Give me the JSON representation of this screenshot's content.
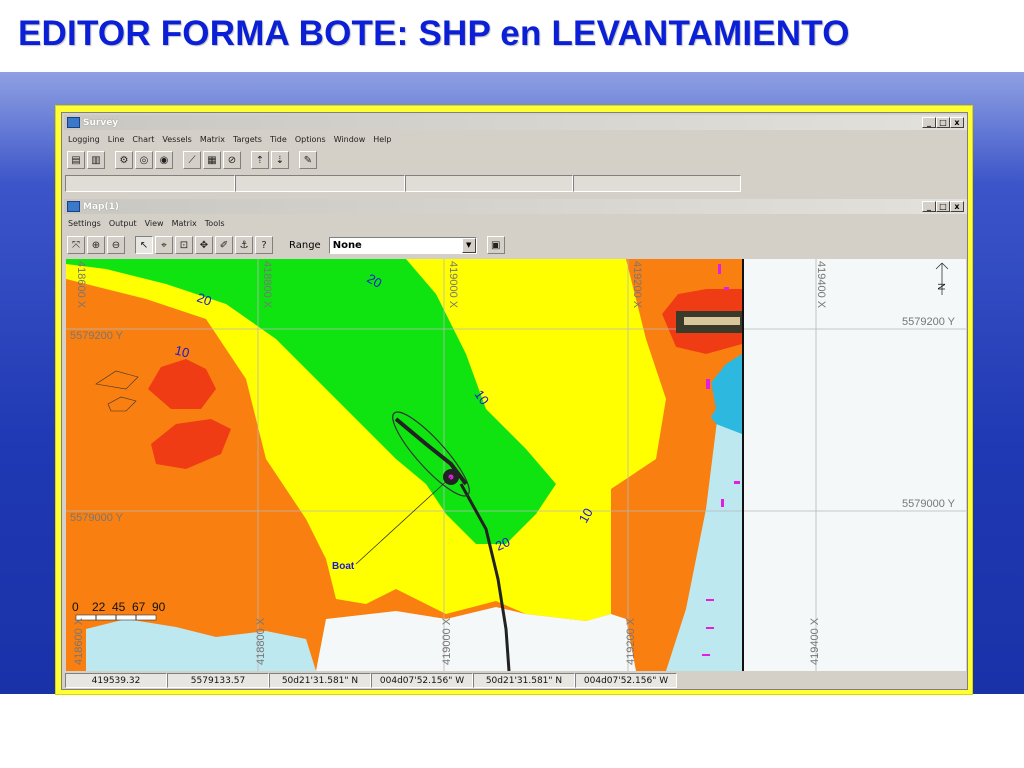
{
  "slide": {
    "title": "EDITOR FORMA BOTE:  SHP en LEVANTAMIENTO"
  },
  "survey_window": {
    "title": "Survey",
    "menu": [
      "Logging",
      "Line",
      "Chart",
      "Vessels",
      "Matrix",
      "Targets",
      "Tide",
      "Options",
      "Window",
      "Help"
    ],
    "buttons": {
      "minimize": "_",
      "maximize": "□",
      "close": "x"
    }
  },
  "map_window": {
    "title": "Map(1)",
    "menu": [
      "Settings",
      "Output",
      "View",
      "Matrix",
      "Tools"
    ],
    "range_label": "Range",
    "range_value": "None",
    "buttons": {
      "minimize": "_",
      "maximize": "□",
      "close": "x"
    }
  },
  "map": {
    "grid_x_labels": [
      "418800 X",
      "419000 X",
      "419200 X",
      "419400 X"
    ],
    "grid_y_labels_left": [
      "5579200 Y",
      "5579000 Y"
    ],
    "grid_y_labels_right": [
      "5579200 Y",
      "5579000 Y"
    ],
    "top_partial_labels": [
      "418600 X",
      "418800 X",
      "419000 X",
      "419200 X",
      "419400 X"
    ],
    "contour_labels": [
      "20",
      "20",
      "10",
      "10",
      "10",
      "20"
    ],
    "boat_label": "Boat",
    "scale_values": [
      "0",
      "22",
      "45",
      "67",
      "90"
    ],
    "north_label": "N",
    "colors": {
      "orange": "#f97f10",
      "red": "#f03c14",
      "yellow": "#ffff00",
      "green": "#10e410",
      "white": "#f4f8f8",
      "light_blue": "#bde8f0",
      "cyan": "#2db8e0",
      "magenta": "#e020e0"
    }
  },
  "status_bar": [
    "419539.32",
    "5579133.57",
    "50d21'31.581\" N",
    "004d07'52.156\" W",
    "50d21'31.581\" N",
    "004d07'52.156\" W"
  ]
}
